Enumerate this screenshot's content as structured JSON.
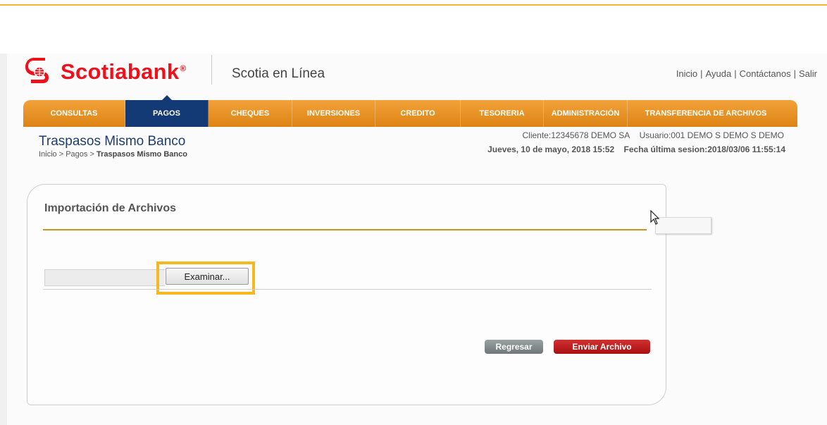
{
  "brand": {
    "name": "Scotiabank",
    "registered": "®",
    "subtitle": "Scotia en Línea",
    "color": "#ec111a"
  },
  "top_links": [
    "Inicio",
    "Ayuda",
    "Contáctanos",
    "Salir"
  ],
  "top_link_separator": "|",
  "nav": {
    "items": [
      "CONSULTAS",
      "PAGOS",
      "CHEQUES",
      "INVERSIONES",
      "CREDITO",
      "TESORERIA",
      "ADMINISTRACIÓN",
      "TRANSFERENCIA DE ARCHIVOS"
    ],
    "active": "PAGOS",
    "color": "#e8931f",
    "active_color": "#143a75"
  },
  "page": {
    "title": "Traspasos Mismo Banco",
    "breadcrumb_prefix": "Inicio > Pagos > ",
    "breadcrumb_current": "Traspasos Mismo Banco"
  },
  "session": {
    "client": "Cliente:12345678  DEMO SA",
    "user": "Usuario:001 DEMO S DEMO S DEMO",
    "date": "Jueves, 10 de mayo, 2018 15:52",
    "last_session": "Fecha última sesion:2018/03/06 11:55:14"
  },
  "panel": {
    "title": "Importación de Archivos",
    "browse_label": "Examinar...",
    "back_label": "Regresar",
    "send_label": "Enviar Archivo",
    "accent_color": "#c9961a",
    "highlight_color": "#f6b81f"
  },
  "icons": {
    "logo": "scotiabank-logo-icon",
    "cursor": "mouse-pointer-icon"
  }
}
